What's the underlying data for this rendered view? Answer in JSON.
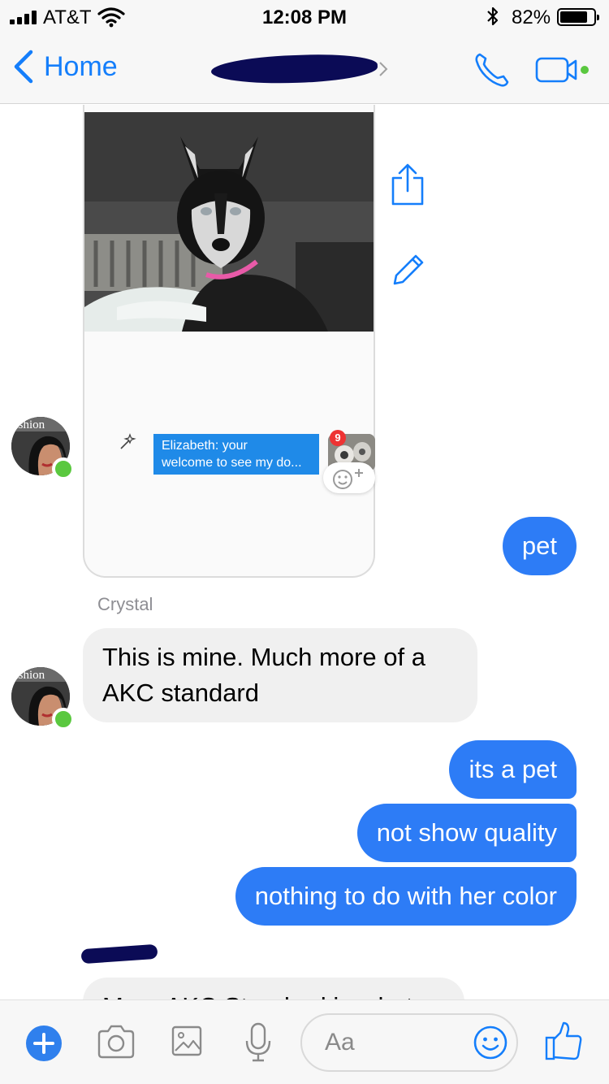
{
  "status_bar": {
    "carrier": "AT&T",
    "time": "12:08 PM",
    "battery_percent": "82%",
    "battery_level": 0.82,
    "signal_bars": 4,
    "icons": [
      "wifi-icon",
      "bluetooth-icon",
      "battery-icon"
    ]
  },
  "nav": {
    "back_label": "Home",
    "title_redacted": true,
    "actions": [
      "phone-icon",
      "video-camera-icon"
    ]
  },
  "shared_media": {
    "notification_text_line1": "Elizabeth: your",
    "notification_text_line2": "welcome to see my do...",
    "notification_badge": "9",
    "side_actions": [
      "share-icon",
      "pencil-icon"
    ]
  },
  "messages": {
    "m1": "pet",
    "sender_crystal": "Crystal",
    "m2": "This is mine. Much more of a AKC standard",
    "m3": "its a pet",
    "m4": "not show quality",
    "m5": "nothing to do with her color",
    "m6_partial": "More AKC Standard in what"
  },
  "composer": {
    "placeholder": "Aa",
    "tools": [
      "plus-icon",
      "camera-icon",
      "photo-icon",
      "microphone-icon",
      "emoji-icon",
      "thumbs-up-icon"
    ]
  },
  "colors": {
    "accent": "#147efb",
    "outgoing_bubble": "#2d7cf6",
    "incoming_bubble": "#f0f0f0",
    "online": "#5ac83f"
  }
}
